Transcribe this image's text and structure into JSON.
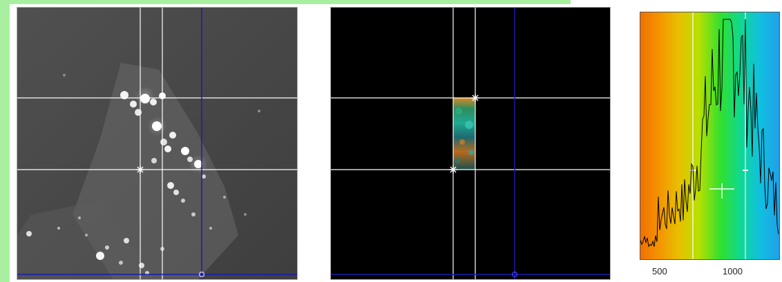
{
  "histogram": {
    "x_tick_labels": [
      "500",
      "1000"
    ]
  },
  "colors": {
    "green_border": "#a8f0a0",
    "crosshair": "#ffffff",
    "cursor_line": "#1a1ab0",
    "histogram_line": "#000000"
  },
  "icons": {
    "crosshair_marker": "crosshair-icon",
    "cursor_marker": "cursor-handle-icon"
  }
}
